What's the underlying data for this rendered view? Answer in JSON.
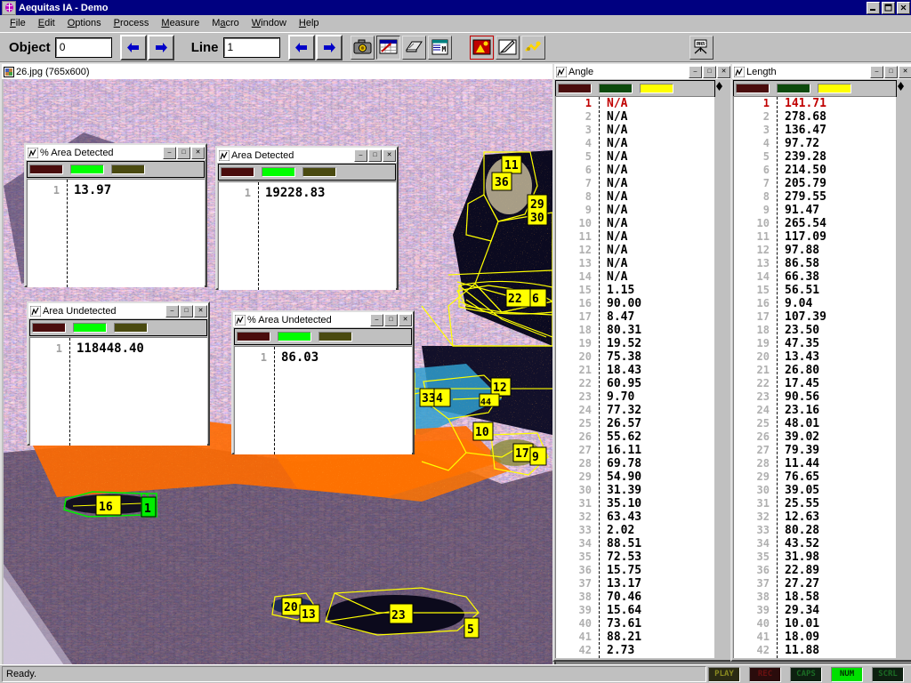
{
  "window": {
    "title": "Aequitas IA - Demo",
    "icon": "app-icon",
    "buttons": {
      "minimize": "_",
      "maximize": "□",
      "close": "✕"
    }
  },
  "menu": {
    "items": [
      {
        "label": "File",
        "accel": "F"
      },
      {
        "label": "Edit",
        "accel": "E"
      },
      {
        "label": "Options",
        "accel": "O"
      },
      {
        "label": "Process",
        "accel": "P"
      },
      {
        "label": "Measure",
        "accel": "M"
      },
      {
        "label": "Macro",
        "accel": "a"
      },
      {
        "label": "Window",
        "accel": "W"
      },
      {
        "label": "Help",
        "accel": "H"
      }
    ]
  },
  "toolbar": {
    "object_label": "Object",
    "object_value": "0",
    "line_label": "Line",
    "line_value": "1",
    "icons": [
      "camera-icon",
      "grid-export-icon",
      "scanner-icon",
      "measure-macro-icon",
      "image-contrast-icon",
      "pencil-edit-icon",
      "sparkle-filter-icon",
      "live-video-icon"
    ]
  },
  "image_window": {
    "title": "26.jpg (765x600)",
    "icon": "image-doc-icon",
    "labels": [
      "11",
      "36",
      "29",
      "30",
      "22",
      "6",
      "33",
      "4",
      "12",
      "10",
      "17",
      "9",
      "16",
      "1",
      "20",
      "13",
      "23",
      "5"
    ]
  },
  "stat_windows": [
    {
      "title": "% Area Detected",
      "icon": "chart-icon",
      "row": "1",
      "value": "13.97",
      "swatches": [
        "#4a0d0d",
        "#00ff00",
        "#4a4a10"
      ]
    },
    {
      "title": "Area Detected",
      "icon": "chart-icon",
      "row": "1",
      "value": "19228.83",
      "swatches": [
        "#4a0d0d",
        "#00ff00",
        "#4a4a10"
      ]
    },
    {
      "title": "Area Undetected",
      "icon": "chart-icon",
      "row": "1",
      "value": "118448.40",
      "swatches": [
        "#4a0d0d",
        "#00ff00",
        "#4a4a10"
      ]
    },
    {
      "title": "% Area Undetected",
      "icon": "chart-icon",
      "row": "1",
      "value": "86.03",
      "swatches": [
        "#4a0d0d",
        "#00ff00",
        "#4a4a10"
      ]
    }
  ],
  "data_windows": [
    {
      "title": "Angle",
      "icon": "chart-icon",
      "swatches": [
        "#4a0d0d",
        "#0d4a0d",
        "#ffff00"
      ],
      "selected_row": 1,
      "rows": [
        {
          "n": "1",
          "v": "N/A"
        },
        {
          "n": "2",
          "v": "N/A"
        },
        {
          "n": "3",
          "v": "N/A"
        },
        {
          "n": "4",
          "v": "N/A"
        },
        {
          "n": "5",
          "v": "N/A"
        },
        {
          "n": "6",
          "v": "N/A"
        },
        {
          "n": "7",
          "v": "N/A"
        },
        {
          "n": "8",
          "v": "N/A"
        },
        {
          "n": "9",
          "v": "N/A"
        },
        {
          "n": "10",
          "v": "N/A"
        },
        {
          "n": "11",
          "v": "N/A"
        },
        {
          "n": "12",
          "v": "N/A"
        },
        {
          "n": "13",
          "v": "N/A"
        },
        {
          "n": "14",
          "v": "N/A"
        },
        {
          "n": "15",
          "v": "1.15"
        },
        {
          "n": "16",
          "v": "90.00"
        },
        {
          "n": "17",
          "v": "8.47"
        },
        {
          "n": "18",
          "v": "80.31"
        },
        {
          "n": "19",
          "v": "19.52"
        },
        {
          "n": "20",
          "v": "75.38"
        },
        {
          "n": "21",
          "v": "18.43"
        },
        {
          "n": "22",
          "v": "60.95"
        },
        {
          "n": "23",
          "v": "9.70"
        },
        {
          "n": "24",
          "v": "77.32"
        },
        {
          "n": "25",
          "v": "26.57"
        },
        {
          "n": "26",
          "v": "55.62"
        },
        {
          "n": "27",
          "v": "16.11"
        },
        {
          "n": "28",
          "v": "69.78"
        },
        {
          "n": "29",
          "v": "54.90"
        },
        {
          "n": "30",
          "v": "31.39"
        },
        {
          "n": "31",
          "v": "35.10"
        },
        {
          "n": "32",
          "v": "63.43"
        },
        {
          "n": "33",
          "v": "2.02"
        },
        {
          "n": "34",
          "v": "88.51"
        },
        {
          "n": "35",
          "v": "72.53"
        },
        {
          "n": "36",
          "v": "15.75"
        },
        {
          "n": "37",
          "v": "13.17"
        },
        {
          "n": "38",
          "v": "70.46"
        },
        {
          "n": "39",
          "v": "15.64"
        },
        {
          "n": "40",
          "v": "73.61"
        },
        {
          "n": "41",
          "v": "88.21"
        },
        {
          "n": "42",
          "v": "2.73"
        }
      ]
    },
    {
      "title": "Length",
      "icon": "chart-icon",
      "swatches": [
        "#4a0d0d",
        "#0d4a0d",
        "#ffff00"
      ],
      "selected_row": 1,
      "rows": [
        {
          "n": "1",
          "v": "141.71"
        },
        {
          "n": "2",
          "v": "278.68"
        },
        {
          "n": "3",
          "v": "136.47"
        },
        {
          "n": "4",
          "v": "97.72"
        },
        {
          "n": "5",
          "v": "239.28"
        },
        {
          "n": "6",
          "v": "214.50"
        },
        {
          "n": "7",
          "v": "205.79"
        },
        {
          "n": "8",
          "v": "279.55"
        },
        {
          "n": "9",
          "v": "91.47"
        },
        {
          "n": "10",
          "v": "265.54"
        },
        {
          "n": "11",
          "v": "117.09"
        },
        {
          "n": "12",
          "v": "97.88"
        },
        {
          "n": "13",
          "v": "86.58"
        },
        {
          "n": "14",
          "v": "66.38"
        },
        {
          "n": "15",
          "v": "56.51"
        },
        {
          "n": "16",
          "v": "9.04"
        },
        {
          "n": "17",
          "v": "107.39"
        },
        {
          "n": "18",
          "v": "23.50"
        },
        {
          "n": "19",
          "v": "47.35"
        },
        {
          "n": "20",
          "v": "13.43"
        },
        {
          "n": "21",
          "v": "26.80"
        },
        {
          "n": "22",
          "v": "17.45"
        },
        {
          "n": "23",
          "v": "90.56"
        },
        {
          "n": "24",
          "v": "23.16"
        },
        {
          "n": "25",
          "v": "48.01"
        },
        {
          "n": "26",
          "v": "39.02"
        },
        {
          "n": "27",
          "v": "79.39"
        },
        {
          "n": "28",
          "v": "11.44"
        },
        {
          "n": "29",
          "v": "76.65"
        },
        {
          "n": "30",
          "v": "39.05"
        },
        {
          "n": "31",
          "v": "25.55"
        },
        {
          "n": "32",
          "v": "12.63"
        },
        {
          "n": "33",
          "v": "80.28"
        },
        {
          "n": "34",
          "v": "43.52"
        },
        {
          "n": "35",
          "v": "31.98"
        },
        {
          "n": "36",
          "v": "22.89"
        },
        {
          "n": "37",
          "v": "27.27"
        },
        {
          "n": "38",
          "v": "18.58"
        },
        {
          "n": "39",
          "v": "29.34"
        },
        {
          "n": "40",
          "v": "10.01"
        },
        {
          "n": "41",
          "v": "18.09"
        },
        {
          "n": "42",
          "v": "11.88"
        }
      ]
    }
  ],
  "statusbar": {
    "message": "Ready.",
    "indicators": [
      {
        "label": "PLAY",
        "active": false,
        "color": "#808000"
      },
      {
        "label": "REC",
        "active": false,
        "color": "#800000"
      },
      {
        "label": "CAPS",
        "active": false,
        "color": "#008000"
      },
      {
        "label": "NUM",
        "active": true,
        "color": "#00ff00"
      },
      {
        "label": "SCRL",
        "active": false,
        "color": "#008000"
      }
    ]
  },
  "colors": {
    "face": "#c0c0c0",
    "titlebar_active": "#000080",
    "annotation": "#ffff00",
    "selected_annotation": "#00ff00",
    "selected_row_text": "#c00000"
  }
}
